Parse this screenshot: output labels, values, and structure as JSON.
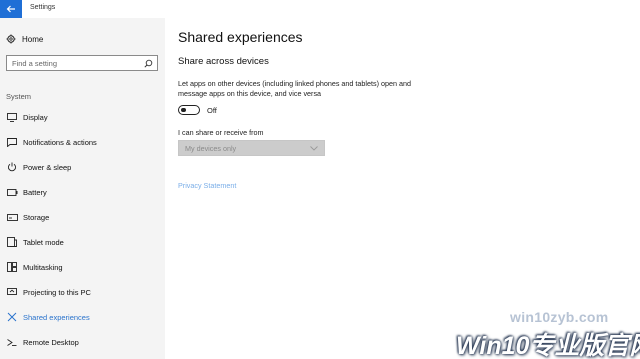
{
  "window": {
    "title": "Settings"
  },
  "sidebar": {
    "home_label": "Home",
    "search_placeholder": "Find a setting",
    "section_label": "System",
    "items": [
      {
        "label": "Display",
        "icon": "display-icon"
      },
      {
        "label": "Notifications & actions",
        "icon": "notifications-icon"
      },
      {
        "label": "Power & sleep",
        "icon": "power-icon"
      },
      {
        "label": "Battery",
        "icon": "battery-icon"
      },
      {
        "label": "Storage",
        "icon": "storage-icon"
      },
      {
        "label": "Tablet mode",
        "icon": "tablet-mode-icon"
      },
      {
        "label": "Multitasking",
        "icon": "multitasking-icon"
      },
      {
        "label": "Projecting to this PC",
        "icon": "projecting-icon"
      },
      {
        "label": "Shared experiences",
        "icon": "shared-experiences-icon",
        "active": true
      },
      {
        "label": "Remote Desktop",
        "icon": "remote-desktop-icon"
      }
    ]
  },
  "main": {
    "title": "Shared experiences",
    "subtitle": "Share across devices",
    "description": "Let apps on other devices (including linked phones and tablets) open and message apps on this device, and vice versa",
    "toggle_state": "Off",
    "share_label": "I can share or receive from",
    "dropdown_value": "My devices only",
    "privacy_link": "Privacy Statement"
  },
  "watermark": {
    "url": "win10zyb.com",
    "brand": "Win10专业版官网"
  },
  "colors": {
    "accent": "#1f6fd6",
    "active_text": "#2a73cc",
    "link": "#7aaee8",
    "sidebar_bg": "#f4f4f4",
    "dropdown_bg": "#cccccc"
  }
}
